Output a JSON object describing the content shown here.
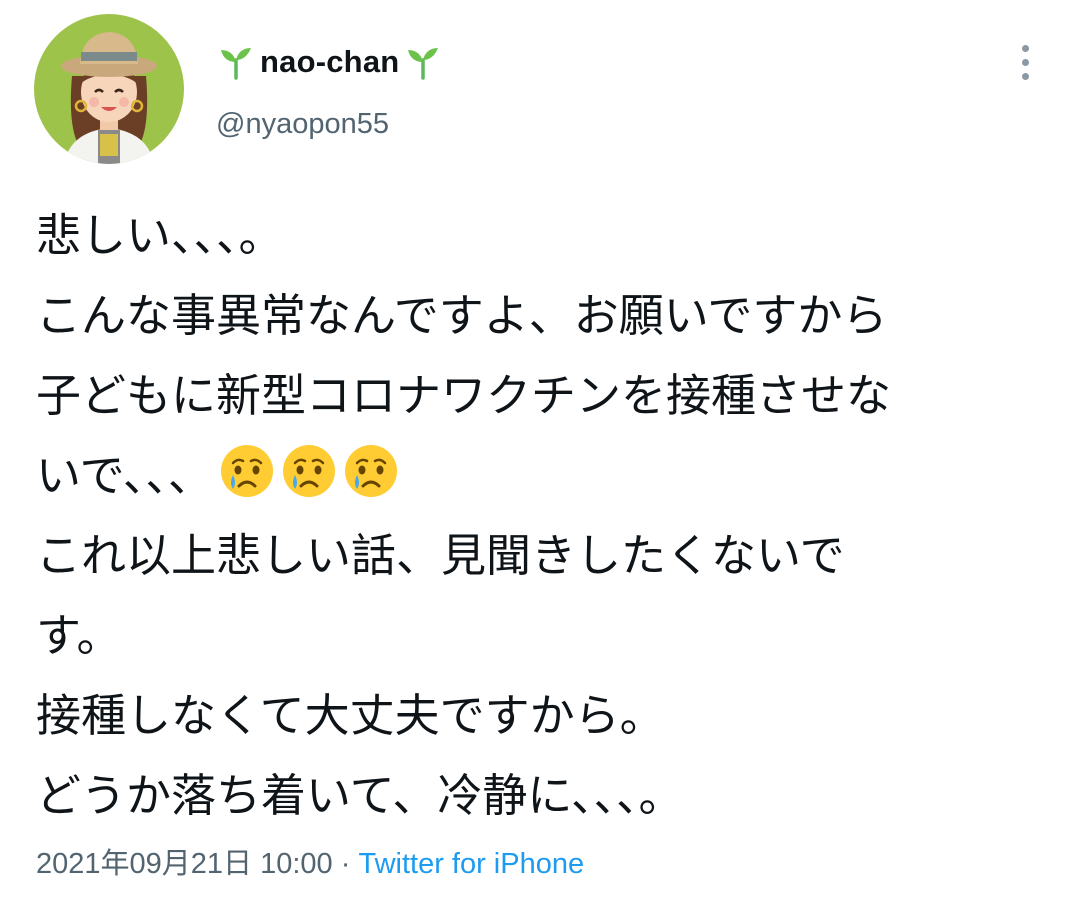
{
  "author": {
    "display_name": "nao-chan",
    "handle": "@nyaopon55",
    "name_decoration_icon": "seedling-icon"
  },
  "tweet": {
    "lines": [
      "悲しい、、、。",
      "こんな事異常なんですよ、お願いですから",
      "子どもに新型コロナワクチンを接種させな",
      "いで、、、",
      "これ以上悲しい話、見聞きしたくないで",
      "す。",
      "接種しなくて大丈夫ですから。",
      "どうか落ち着いて、冷静に、、、。"
    ],
    "emoji": [
      "crying-face-icon",
      "crying-face-icon",
      "crying-face-icon"
    ]
  },
  "meta": {
    "timestamp": "2021年09月21日 10:00",
    "separator": "·",
    "source": "Twitter for iPhone"
  },
  "colors": {
    "text_primary": "#0f1419",
    "text_secondary": "#536471",
    "link": "#1d9bf0",
    "avatar_bg": "#9dc34a",
    "seedling": "#5cb85c"
  }
}
